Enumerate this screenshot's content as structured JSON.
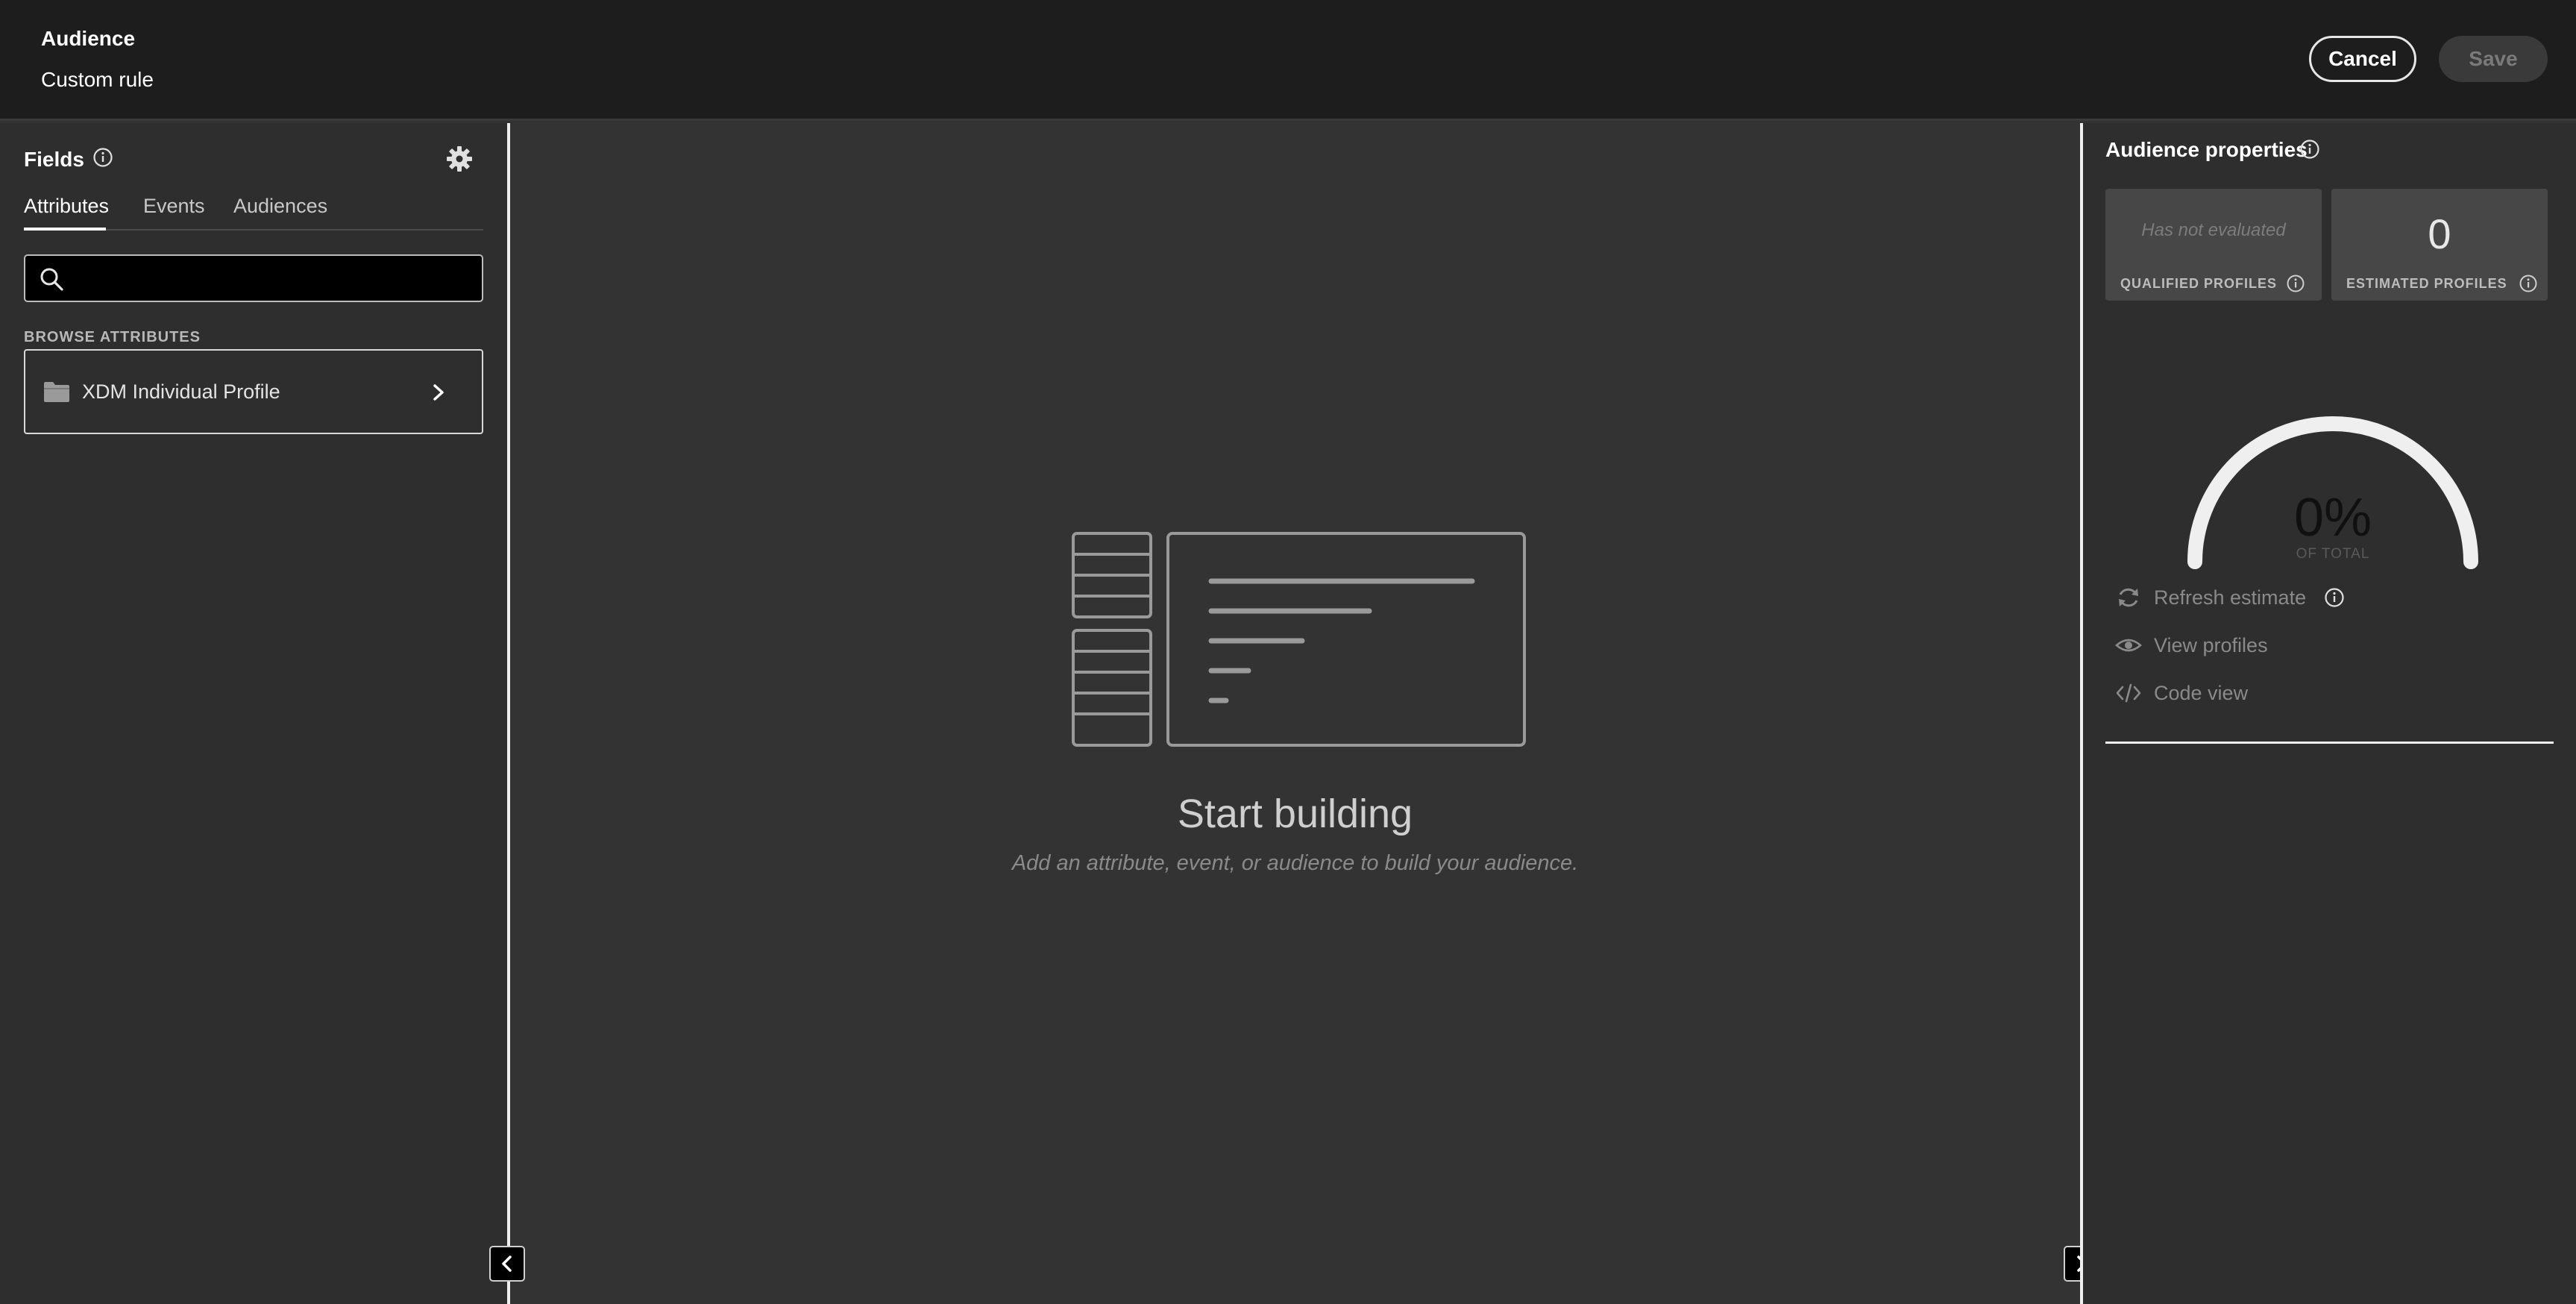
{
  "header": {
    "title": "Audience",
    "subtitle": "Custom rule",
    "cancel_label": "Cancel",
    "save_label": "Save"
  },
  "fields_panel": {
    "title": "Fields",
    "tabs": [
      {
        "label": "Attributes",
        "active": true
      },
      {
        "label": "Events",
        "active": false
      },
      {
        "label": "Audiences",
        "active": false
      }
    ],
    "search": {
      "value": "",
      "placeholder": ""
    },
    "browse_label": "BROWSE ATTRIBUTES",
    "browse_items": [
      {
        "label": "XDM Individual Profile",
        "icon": "folder-icon"
      }
    ]
  },
  "canvas": {
    "empty_title": "Start building",
    "empty_subtitle": "Add an attribute, event, or audience to build your audience."
  },
  "properties_panel": {
    "title": "Audience properties",
    "qualified": {
      "value": "Has not evaluated",
      "label": "QUALIFIED PROFILES"
    },
    "estimated": {
      "value": "0",
      "label": "ESTIMATED PROFILES"
    },
    "gauge": {
      "percent_text": "0%",
      "sub_label": "OF TOTAL",
      "fraction": 0
    },
    "actions": [
      {
        "label": "Refresh estimate",
        "icon": "refresh-icon"
      },
      {
        "label": "View profiles",
        "icon": "eye-icon"
      },
      {
        "label": "Code view",
        "icon": "code-icon"
      }
    ]
  },
  "colors": {
    "header_bg": "#1d1d1d",
    "panel_bg": "#2e2e2e",
    "canvas_bg": "#333333",
    "card_bg": "#474747",
    "gauge_arc": "#efefef"
  }
}
